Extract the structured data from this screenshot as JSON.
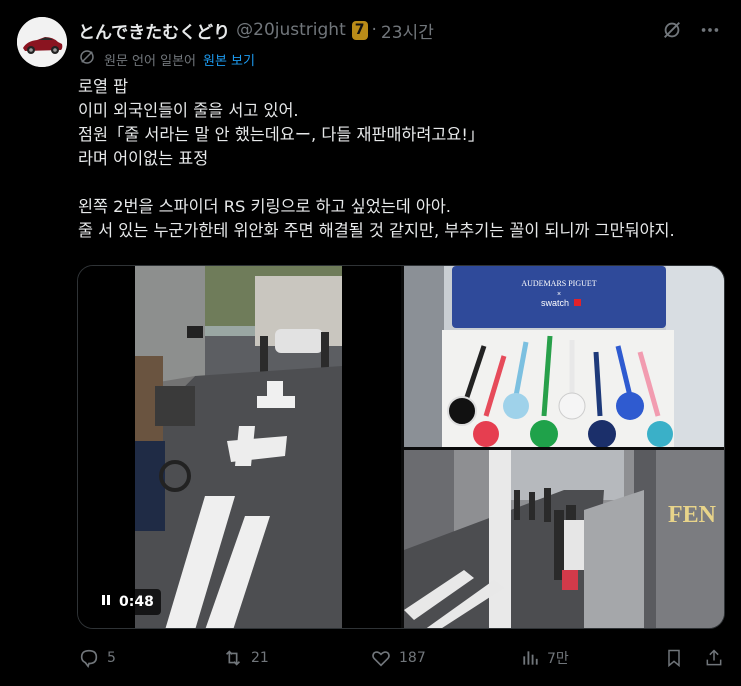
{
  "tweet": {
    "display_name": "とんできたむくどり",
    "handle": "@20justright",
    "badge": "7",
    "separator": "·",
    "time": "23시간",
    "translation": {
      "source_label": "원문 언어 일본어",
      "view_original": "원본 보기"
    },
    "lines": [
      "로열 팝",
      "이미 외국인들이 줄을 서고 있어.",
      "점원「줄 서라는 말 안 했는데요ー, 다들 재판매하려고요!」",
      "라며 어이없는 표정",
      "",
      "왼쪽 2번을 스파이더 RS 키링으로 하고 싶었는데 아아.",
      "줄 서 있는 누군가한테 위안화 주면 해결될 것 같지만, 부추기는 꼴이 되니까 그만둬야지."
    ],
    "media": {
      "video_time": "0:48",
      "brand_line1": "AUDEMARS PIGUET",
      "brand_x": "×",
      "brand_line2": "swatch",
      "store_sign": "FEN"
    },
    "actions": {
      "replies": "5",
      "retweets": "21",
      "likes": "187",
      "views": "7만"
    },
    "icons": [
      "grok-icon",
      "more-icon",
      "translate-icon",
      "reply-icon",
      "retweet-icon",
      "like-icon",
      "views-icon",
      "bookmark-icon",
      "share-icon",
      "pause-icon"
    ],
    "colors": {
      "background": "#000000",
      "text": "#e7e9ea",
      "muted": "#71767b",
      "link": "#1d9bf0",
      "badge": "#b98b18"
    }
  }
}
